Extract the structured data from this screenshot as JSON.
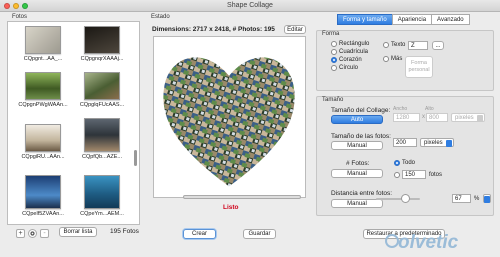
{
  "window": {
    "title": "Shape Collage"
  },
  "photos": {
    "label": "Fotos",
    "items": [
      {
        "caption": "CQpgnt...AA_...",
        "color": "#b9b7ad"
      },
      {
        "caption": "CQpgnqrXAAAj...",
        "color": "#2e2a25"
      },
      {
        "caption": "CQpgnPWgWAAn...",
        "color": "#5b7d38"
      },
      {
        "caption": "CQpglqFUcAAS...",
        "color": "#6a7e4f"
      },
      {
        "caption": "CQpgiRU...AAn...",
        "color": "#d4c8b6"
      },
      {
        "caption": "CQpfQb...AZE...",
        "color": "#3f4952"
      },
      {
        "caption": "CQpelf5ZVAAn...",
        "color": "#2f5a8c"
      },
      {
        "caption": "CQpeYm...AEM...",
        "color": "#2a6e96"
      }
    ],
    "add_label": "+",
    "remove_label": "-",
    "clear_label": "Borrar lista",
    "count_label": "195 Fotos"
  },
  "estado": {
    "label": "Estado",
    "dimensions": "Dimensions: 2717 x 2418, # Photos: 195",
    "edit_label": "Editar",
    "status": "Listo"
  },
  "actions": {
    "create": "Crear",
    "save": "Guardar",
    "reset": "Restaurar a predeterminado"
  },
  "tabs": [
    "Forma y tamaño",
    "Apariencia",
    "Avanzado"
  ],
  "forma": {
    "label": "Forma",
    "options": [
      "Rectángulo",
      "Cuadrícula",
      "Corazón",
      "Círculo"
    ],
    "selected": "Corazón",
    "texto_label": "Texto",
    "texto_value": "Z",
    "texto_more": "...",
    "mas_label": "Más",
    "custom_label": "Forma personal"
  },
  "tamano": {
    "label": "Tamaño",
    "collage_label": "Tamaño del Collage:",
    "collage_mode": "Auto",
    "ancho_label": "Ancho",
    "alto_label": "Alto",
    "ancho_value": "1280",
    "alto_value": "800",
    "times": "x",
    "unit_disabled": "pixeles",
    "fotos_size_label": "Tamaño de las fotos:",
    "fotos_size_mode": "Manual",
    "fotos_size_value": "200",
    "fotos_size_unit": "pixeles",
    "num_fotos_label": "# Fotos:",
    "num_fotos_mode": "Manual",
    "num_todo": "Todo",
    "num_value": "150",
    "num_unit": "fotos",
    "num_selected": "Todo",
    "distance_label": "Distancia entre fotos:",
    "distance_mode": "Manual",
    "distance_value": "67",
    "distance_unit": "%",
    "distance_level": 0.67
  },
  "watermark": "olvetic",
  "colors": {
    "accent": "#2f7de1",
    "status_red": "#d0021b"
  }
}
